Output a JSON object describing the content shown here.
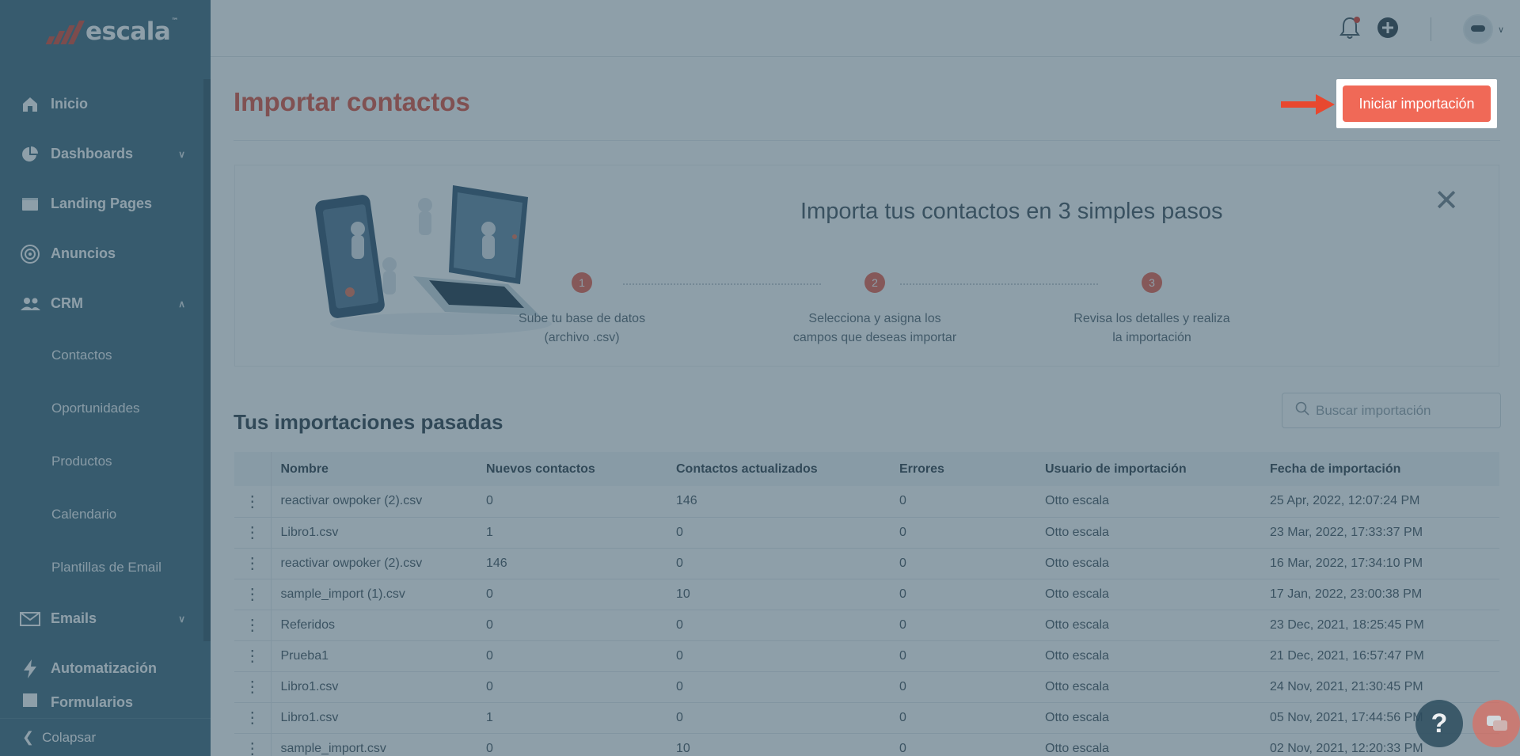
{
  "brand": {
    "name": "escala",
    "tm": "™"
  },
  "sidebar": {
    "items": [
      {
        "label": "Inicio",
        "icon": "home-icon"
      },
      {
        "label": "Dashboards",
        "icon": "pie-chart-icon"
      },
      {
        "label": "Landing Pages",
        "icon": "browser-window-icon"
      },
      {
        "label": "Anuncios",
        "icon": "target-icon"
      },
      {
        "label": "CRM",
        "icon": "users-icon"
      }
    ],
    "crm_sub": [
      "Contactos",
      "Oportunidades",
      "Productos",
      "Calendario",
      "Plantillas de Email"
    ],
    "emails": {
      "label": "Emails",
      "icon": "mail-icon"
    },
    "automation": {
      "label": "Automatización",
      "icon": "lightning-icon"
    },
    "partial": {
      "label": "Formularios"
    },
    "collapse": "Colapsar"
  },
  "header": {
    "icons": [
      "bell-icon",
      "plus-circle-icon",
      "avatar"
    ]
  },
  "page": {
    "title": "Importar contactos",
    "start_button": "Iniciar importación",
    "steps_title": "Importa tus contactos en 3 simples pasos",
    "steps": [
      {
        "num": "1",
        "line1": "Sube tu base de datos",
        "line2": "(archivo .csv)"
      },
      {
        "num": "2",
        "line1": "Selecciona y asigna los",
        "line2": "campos que deseas importar"
      },
      {
        "num": "3",
        "line1": "Revisa los detalles y realiza",
        "line2": "la importación"
      }
    ],
    "past_title": "Tus importaciones pasadas",
    "search_placeholder": "Buscar importación"
  },
  "table": {
    "headers": [
      "Nombre",
      "Nuevos contactos",
      "Contactos actualizados",
      "Errores",
      "Usuario de importación",
      "Fecha de importación"
    ],
    "rows": [
      [
        "reactivar owpoker (2).csv",
        "0",
        "146",
        "0",
        "Otto escala",
        "25 Apr, 2022, 12:07:24 PM"
      ],
      [
        "Libro1.csv",
        "1",
        "0",
        "0",
        "Otto escala",
        "23 Mar, 2022, 17:33:37 PM"
      ],
      [
        "reactivar owpoker (2).csv",
        "146",
        "0",
        "0",
        "Otto escala",
        "16 Mar, 2022, 17:34:10 PM"
      ],
      [
        "sample_import (1).csv",
        "0",
        "10",
        "0",
        "Otto escala",
        "17 Jan, 2022, 23:00:38 PM"
      ],
      [
        "Referidos",
        "0",
        "0",
        "0",
        "Otto escala",
        "23 Dec, 2021, 18:25:45 PM"
      ],
      [
        "Prueba1",
        "0",
        "0",
        "0",
        "Otto escala",
        "21 Dec, 2021, 16:57:47 PM"
      ],
      [
        "Libro1.csv",
        "0",
        "0",
        "0",
        "Otto escala",
        "24 Nov, 2021, 21:30:45 PM"
      ],
      [
        "Libro1.csv",
        "1",
        "0",
        "0",
        "Otto escala",
        "05 Nov, 2021, 17:44:56 PM"
      ],
      [
        "sample_import.csv",
        "0",
        "10",
        "0",
        "Otto escala",
        "02 Nov, 2021, 12:20:33 PM"
      ]
    ]
  },
  "help": {
    "label": "?"
  },
  "colors": {
    "accent": "#f06957",
    "sidebar": "#4a7184",
    "overlay": "rgba(38,70,90,0.52)"
  }
}
